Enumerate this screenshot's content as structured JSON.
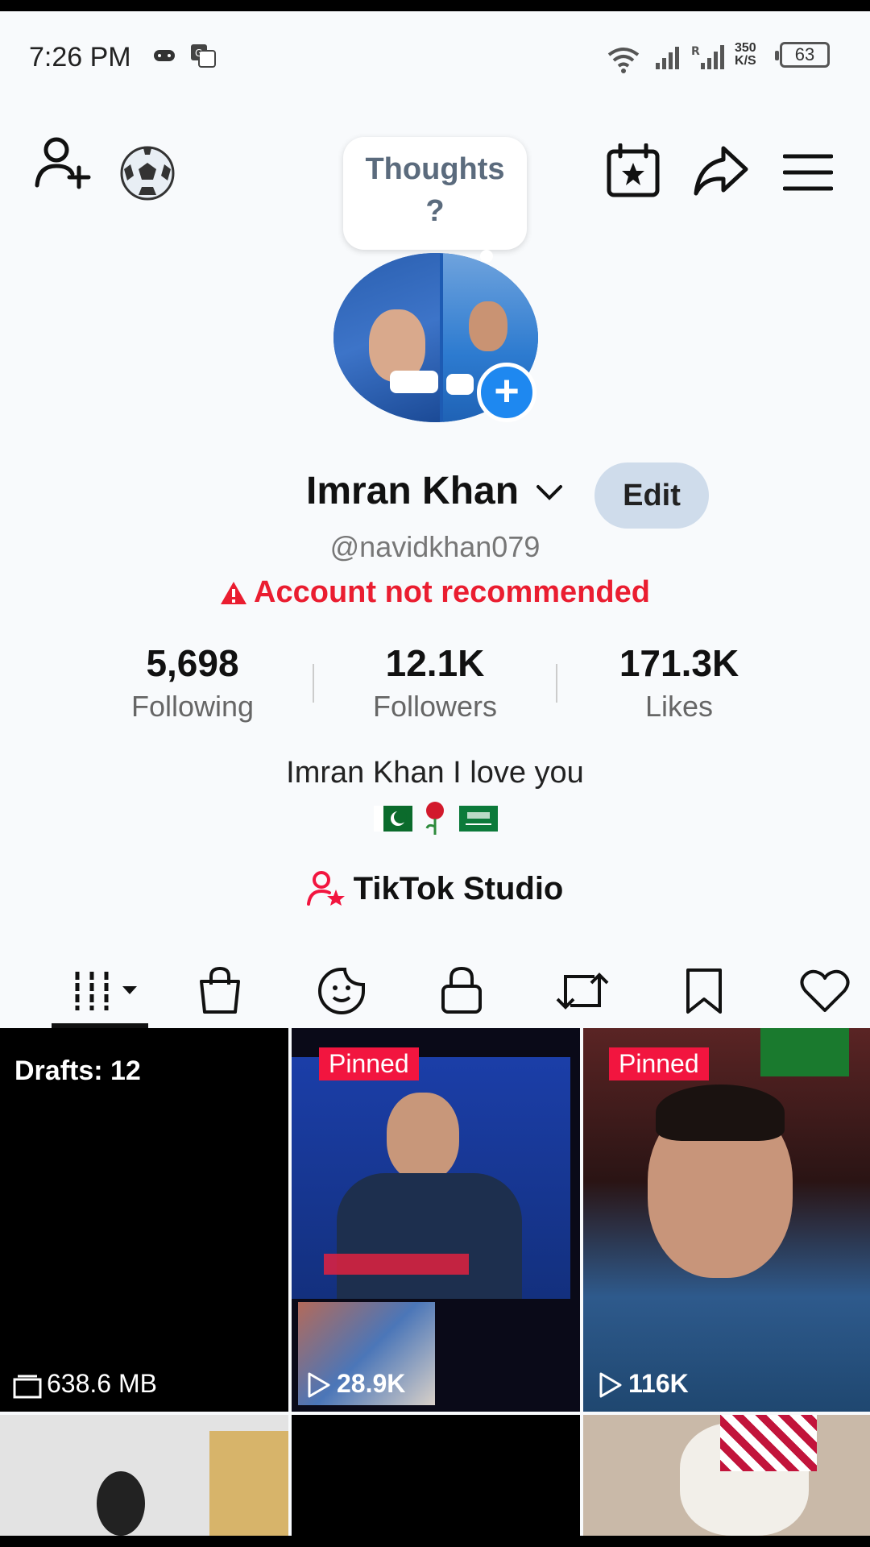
{
  "status_bar": {
    "time": "7:26 PM",
    "speed_value": "350",
    "speed_unit": "K/S",
    "battery": "63",
    "icons": [
      "game-controller-icon",
      "translate-icon",
      "wifi-icon",
      "signal-icon",
      "signal-roaming-icon"
    ]
  },
  "top_bar": {
    "icons": [
      "add-friend-icon",
      "soccer-ball-icon",
      "calendar-star-icon",
      "share-icon",
      "menu-icon"
    ]
  },
  "profile": {
    "thought_prompt": "Thoughts ?",
    "name": "Imran Khan",
    "edit_label": "Edit",
    "handle": "@navidkhan079",
    "warning": "Account not recommended",
    "bio": "Imran Khan I love you",
    "bio_emoji": [
      "flag-pakistan",
      "rose",
      "flag-saudi-arabia"
    ],
    "studio_label": "TikTok Studio"
  },
  "stats": [
    {
      "value": "5,698",
      "label": "Following"
    },
    {
      "value": "12.1K",
      "label": "Followers"
    },
    {
      "value": "171.3K",
      "label": "Likes"
    }
  ],
  "tabs": [
    "videos-grid-icon",
    "shop-bag-icon",
    "sticker-icon",
    "lock-icon",
    "repost-icon",
    "bookmark-icon",
    "heart-icon"
  ],
  "grid": {
    "drafts_label": "Drafts: 12",
    "drafts_size": "638.6 MB",
    "videos": [
      {
        "badge": "Pinned",
        "views": "28.9K"
      },
      {
        "badge": "Pinned",
        "views": "116K"
      }
    ]
  },
  "colors": {
    "warning": "#ea1d30",
    "pinned": "#f2153f",
    "accent": "#1e88f0",
    "edit_bg": "#cfdceb"
  }
}
